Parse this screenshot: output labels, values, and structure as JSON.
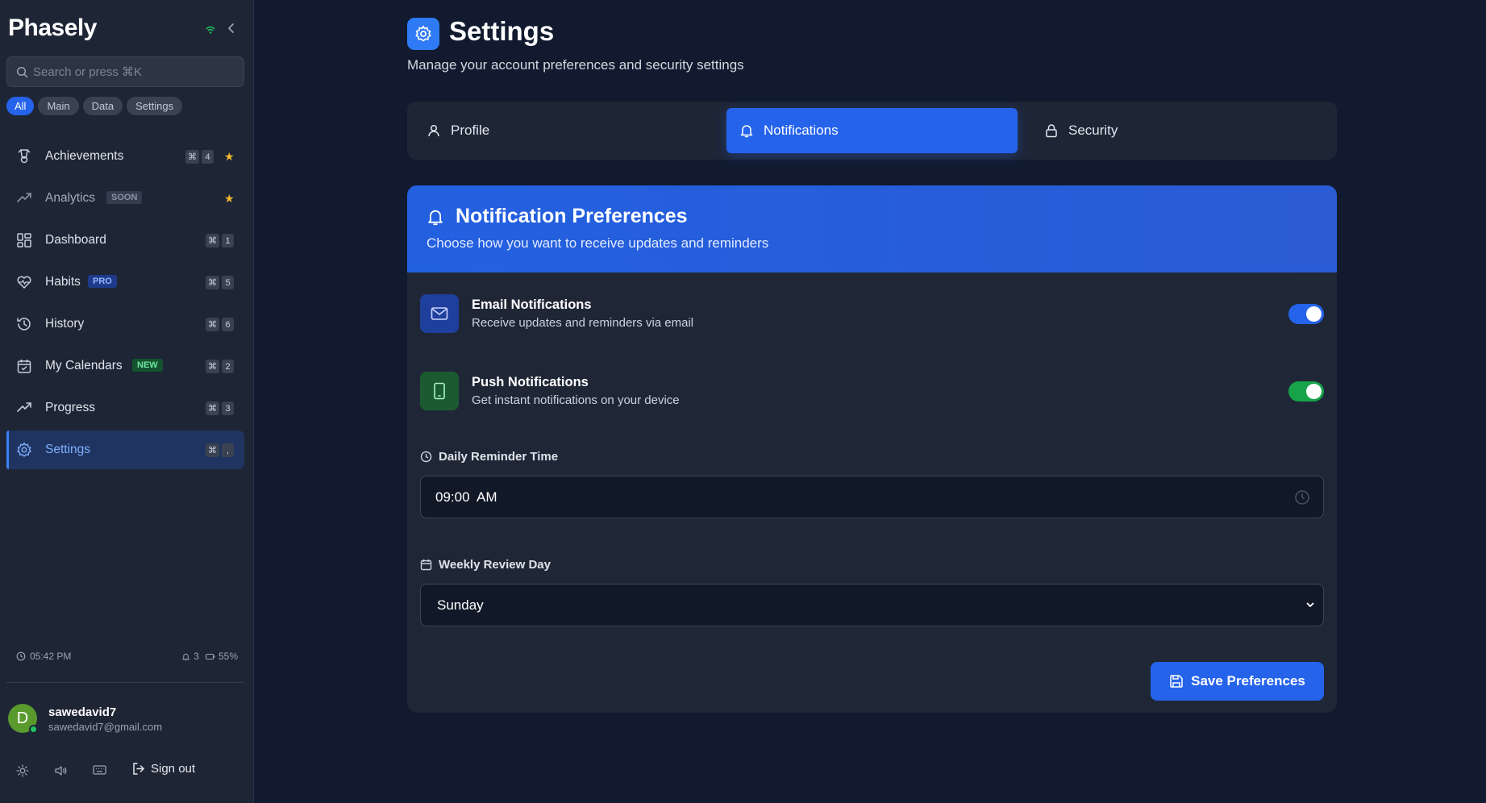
{
  "app": {
    "logo": "Phasely"
  },
  "search": {
    "placeholder": "Search or press ⌘K"
  },
  "filters": [
    "All",
    "Main",
    "Data",
    "Settings"
  ],
  "sidebar": {
    "items": [
      {
        "label": "Achievements",
        "badge": "",
        "shortcut_mod": "⌘",
        "shortcut_key": "4",
        "starred": true
      },
      {
        "label": "Analytics",
        "badge": "SOON",
        "shortcut_mod": "",
        "shortcut_key": "",
        "starred": true
      },
      {
        "label": "Dashboard",
        "badge": "",
        "shortcut_mod": "⌘",
        "shortcut_key": "1",
        "starred": false
      },
      {
        "label": "Habits",
        "badge": "PRO",
        "shortcut_mod": "⌘",
        "shortcut_key": "5",
        "starred": false
      },
      {
        "label": "History",
        "badge": "",
        "shortcut_mod": "⌘",
        "shortcut_key": "6",
        "starred": false
      },
      {
        "label": "My Calendars",
        "badge": "NEW",
        "shortcut_mod": "⌘",
        "shortcut_key": "2",
        "starred": false
      },
      {
        "label": "Progress",
        "badge": "",
        "shortcut_mod": "⌘",
        "shortcut_key": "3",
        "starred": false
      },
      {
        "label": "Settings",
        "badge": "",
        "shortcut_mod": "⌘",
        "shortcut_key": ",",
        "starred": false,
        "active": true
      }
    ],
    "star_glyph": "★"
  },
  "status": {
    "time": "05:42 PM",
    "notifications": "3",
    "battery": "55%"
  },
  "user": {
    "initial": "D",
    "name": "sawedavid7",
    "email": "sawedavid7@gmail.com"
  },
  "footer": {
    "sign_out": "Sign out"
  },
  "page": {
    "title": "Settings",
    "subtitle": "Manage your account preferences and security settings"
  },
  "tabs": [
    {
      "label": "Profile",
      "icon": "user-icon"
    },
    {
      "label": "Notifications",
      "icon": "bell-icon",
      "active": true
    },
    {
      "label": "Security",
      "icon": "lock-icon"
    }
  ],
  "notifications_card": {
    "title": "Notification Preferences",
    "subtitle": "Choose how you want to receive updates and reminders",
    "email": {
      "title": "Email Notifications",
      "desc": "Receive updates and reminders via email",
      "enabled": true
    },
    "push": {
      "title": "Push Notifications",
      "desc": "Get instant notifications on your device",
      "enabled": true
    },
    "reminder": {
      "label": "Daily Reminder Time",
      "value": "09:00  AM"
    },
    "review": {
      "label": "Weekly Review Day",
      "value": "Sunday"
    },
    "save_label": "Save Preferences"
  },
  "colors": {
    "accent": "#2563eb",
    "success": "#16a34a",
    "star": "#f5b82e",
    "background": "#111a2e",
    "sidebar": "#1e2636"
  }
}
